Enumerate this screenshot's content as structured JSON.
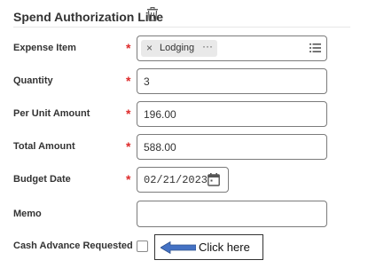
{
  "header": {
    "title": "Spend Authorization Line",
    "delete_icon": "trash-icon"
  },
  "required_marker": "*",
  "fields": {
    "expense_item": {
      "label": "Expense Item",
      "pill": "Lodging",
      "pill_remove": "×",
      "pill_more": "···",
      "icon": "list-icon"
    },
    "quantity": {
      "label": "Quantity",
      "value": "3"
    },
    "per_unit_amount": {
      "label": "Per Unit Amount",
      "value": "196.00"
    },
    "total_amount": {
      "label": "Total Amount",
      "value": "588.00"
    },
    "budget_date": {
      "label": "Budget Date",
      "value": "02/21/2023",
      "icon": "calendar-icon"
    },
    "memo": {
      "label": "Memo",
      "value": ""
    },
    "cash_advance": {
      "label": "Cash Advance Requested",
      "checked": false
    }
  },
  "callout": {
    "text": "Click here",
    "arrow_color": "#4472c4"
  }
}
